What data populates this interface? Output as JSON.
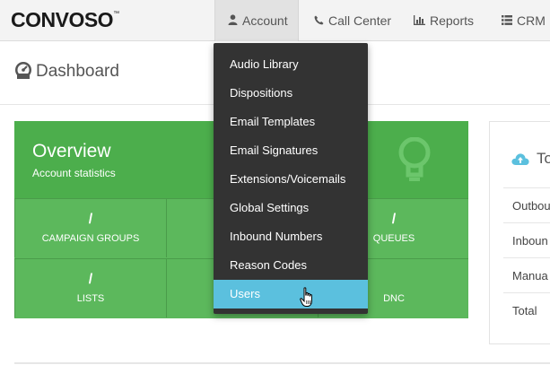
{
  "logo": "CONVOSO",
  "nav": {
    "account": "Account",
    "callcenter": "Call Center",
    "reports": "Reports",
    "crm": "CRM"
  },
  "page_title": "Dashboard",
  "overview": {
    "title": "Overview",
    "subtitle": "Account statistics",
    "stats": [
      {
        "value": "/",
        "label": "CAMPAIGN GROUPS"
      },
      {
        "value": "",
        "label": ""
      },
      {
        "value": "/",
        "label": "QUEUES"
      },
      {
        "value": "/",
        "label": "LISTS"
      },
      {
        "value": "",
        "label": ""
      },
      {
        "value": "",
        "label": "DNC"
      }
    ]
  },
  "totals": {
    "title": "To",
    "rows": [
      "Outbou",
      "Inboun",
      "Manua",
      "Total"
    ]
  },
  "dropdown": {
    "items": [
      "Audio Library",
      "Dispositions",
      "Email Templates",
      "Email Signatures",
      "Extensions/Voicemails",
      "Global Settings",
      "Inbound Numbers",
      "Reason Codes",
      "Users"
    ],
    "active_index": 8
  },
  "colors": {
    "overview_green": "#5cb85c",
    "menu_bg": "#333333",
    "menu_active": "#5bc0de"
  }
}
